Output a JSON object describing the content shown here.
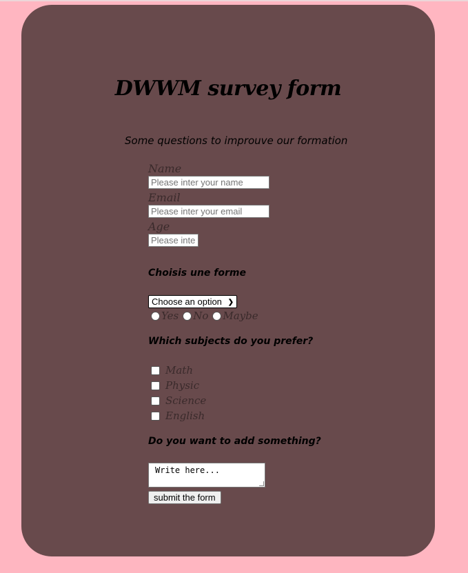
{
  "page": {
    "title": "DWWM survey form",
    "subtitle": "Some questions to improuve our formation"
  },
  "form": {
    "name": {
      "label": "Name",
      "placeholder": "Please inter your name"
    },
    "email": {
      "label": "Email",
      "placeholder": "Please inter your email"
    },
    "age": {
      "label": "Age",
      "placeholder": "Please inter your age"
    },
    "shape_question": "Choisis une forme",
    "select": {
      "selected": "Choose an option"
    },
    "radios": [
      "Yes",
      "No",
      "Maybe"
    ],
    "subjects_question": "Which subjects do you prefer?",
    "subjects": [
      "Math",
      "Physic",
      "Science",
      "English"
    ],
    "extra_question": "Do you want to add something?",
    "textarea_placeholder": "Write here...",
    "submit_label": "submit the form"
  },
  "colors": {
    "background": "#ffb6c1",
    "card": "#684a4c"
  }
}
